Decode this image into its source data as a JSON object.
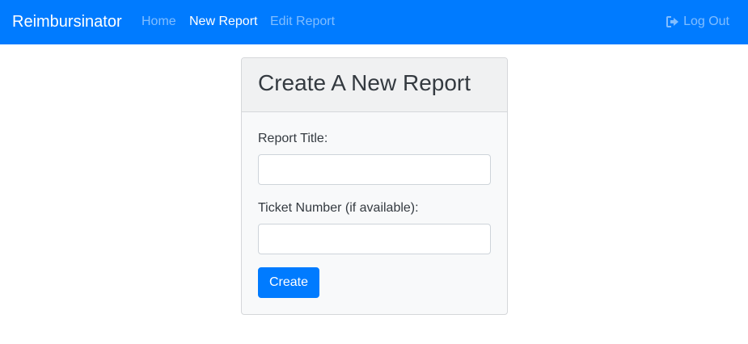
{
  "navbar": {
    "brand": "Reimbursinator",
    "links": [
      {
        "label": "Home",
        "active": false
      },
      {
        "label": "New Report",
        "active": true
      },
      {
        "label": "Edit Report",
        "active": false
      }
    ],
    "logout_label": "Log Out",
    "logout_icon": "sign-out-icon",
    "background_color": "#007bff"
  },
  "form": {
    "title": "Create A New Report",
    "report_title_label": "Report Title:",
    "report_title_value": "",
    "report_title_placeholder": "",
    "ticket_label": "Ticket Number (if available):",
    "ticket_value": "",
    "ticket_placeholder": "",
    "submit_label": "Create"
  }
}
